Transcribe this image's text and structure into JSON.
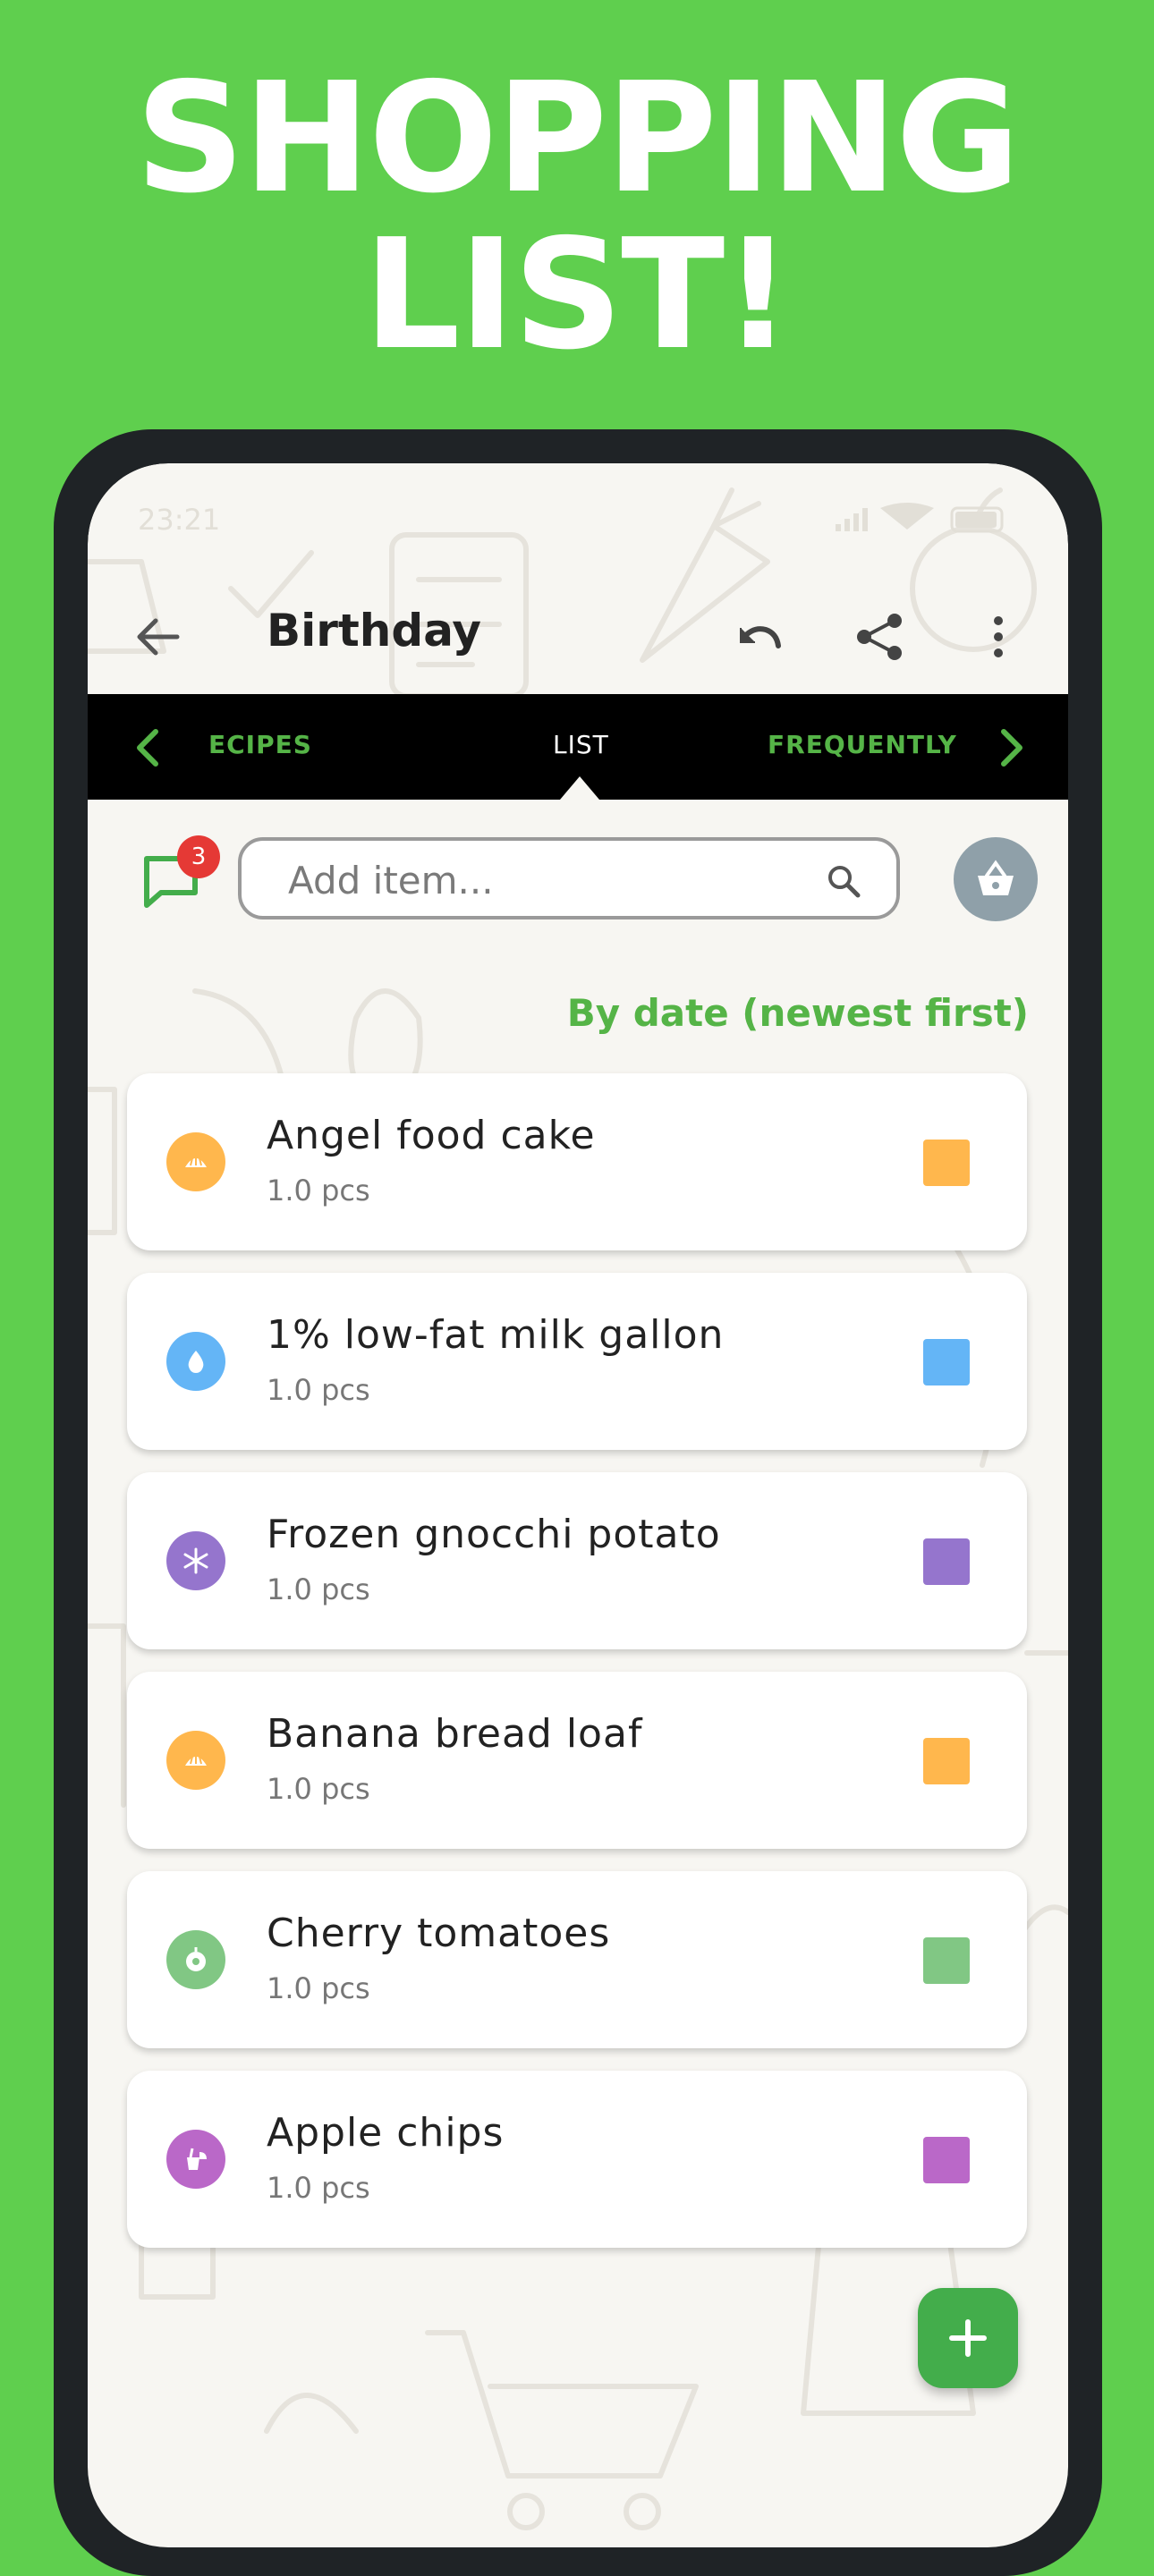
{
  "headline": {
    "line1": "Shopping",
    "line2": "List!"
  },
  "status_bar": {
    "time": "23:21"
  },
  "app_bar": {
    "title": "Birthday",
    "back_icon": "arrow-left-icon",
    "undo_icon": "undo-icon",
    "share_icon": "share-icon",
    "more_icon": "more-vertical-icon"
  },
  "tabs": {
    "items": [
      "ECIPES",
      "LIST",
      "FREQUENTLY"
    ],
    "active": "LIST"
  },
  "toolbar": {
    "chat_badge": "3",
    "search_placeholder": "Add item...",
    "basket_icon": "basket-icon"
  },
  "sort_label": "By date (newest first)",
  "items": [
    {
      "name": "Angel food cake",
      "qty": "1.0 pcs",
      "color": "#ffb74d",
      "icon": "bakery-icon"
    },
    {
      "name": "1% low-fat milk gallon",
      "qty": "1.0 pcs",
      "color": "#64b5f6",
      "icon": "milk-drop-icon"
    },
    {
      "name": "Frozen gnocchi potato",
      "qty": "1.0 pcs",
      "color": "#9575cd",
      "icon": "snowflake-icon"
    },
    {
      "name": "Banana bread loaf",
      "qty": "1.0 pcs",
      "color": "#ffb74d",
      "icon": "bakery-icon"
    },
    {
      "name": "Cherry tomatoes",
      "qty": "1.0 pcs",
      "color": "#81c784",
      "icon": "produce-icon"
    },
    {
      "name": "Apple chips",
      "qty": "1.0 pcs",
      "color": "#ba68c8",
      "icon": "snack-icon"
    }
  ],
  "fab_icon": "plus-icon",
  "colors": {
    "background": "#5fcf4e",
    "accent": "#55b447",
    "fab": "#43ad4b",
    "badge": "#e53935"
  }
}
